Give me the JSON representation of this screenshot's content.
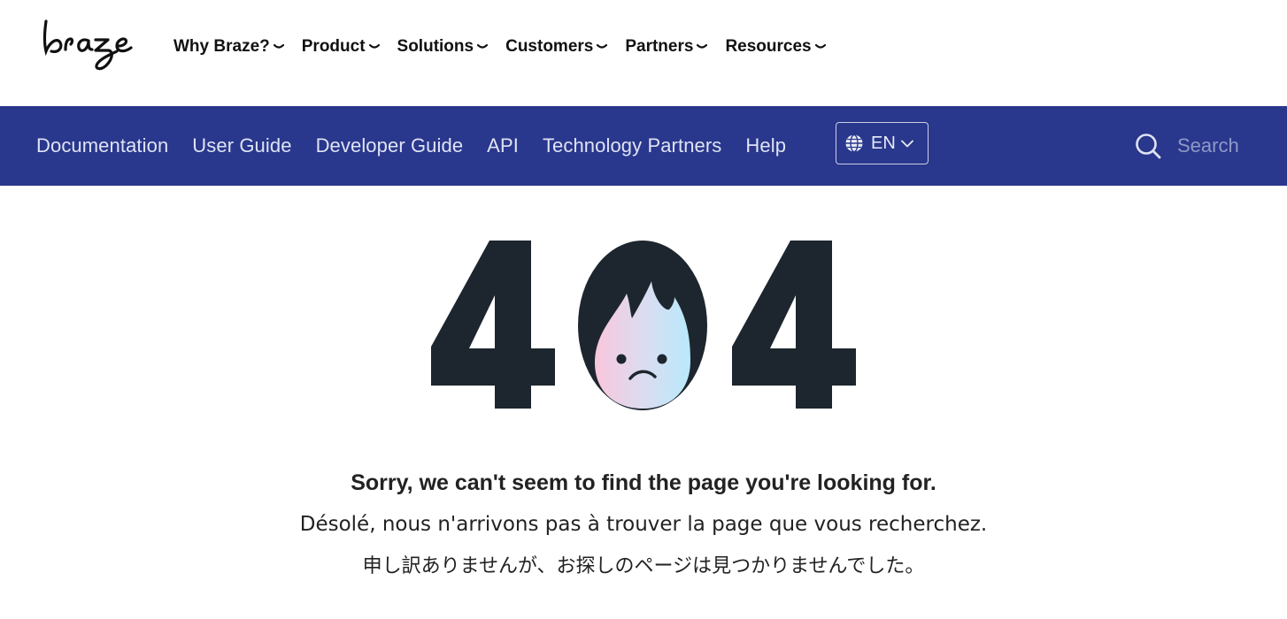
{
  "brand": {
    "logo_text": "braze"
  },
  "main_nav": {
    "items": [
      {
        "label": "Why Braze?"
      },
      {
        "label": "Product"
      },
      {
        "label": "Solutions"
      },
      {
        "label": "Customers"
      },
      {
        "label": "Partners"
      },
      {
        "label": "Resources"
      }
    ]
  },
  "doc_nav": {
    "links": [
      {
        "label": "Documentation"
      },
      {
        "label": "User Guide"
      },
      {
        "label": "Developer Guide"
      },
      {
        "label": "API"
      },
      {
        "label": "Technology Partners"
      },
      {
        "label": "Help"
      }
    ],
    "language": {
      "code": "EN",
      "icon": "globe-icon"
    },
    "search": {
      "placeholder": "Search",
      "icon": "search-icon"
    }
  },
  "error": {
    "code_digits": [
      "4",
      "0",
      "4"
    ],
    "message_en": "Sorry, we can't seem to find the page you're looking for.",
    "message_fr": "Désolé, nous n'arrivons pas à trouver la page que vous recherchez.",
    "message_ja": "申し訳ありませんが、お探しのページは見つかりませんでした。"
  },
  "colors": {
    "docbar_bg": "#29378c",
    "digit_color": "#1d262e",
    "text_dark": "#222222"
  }
}
